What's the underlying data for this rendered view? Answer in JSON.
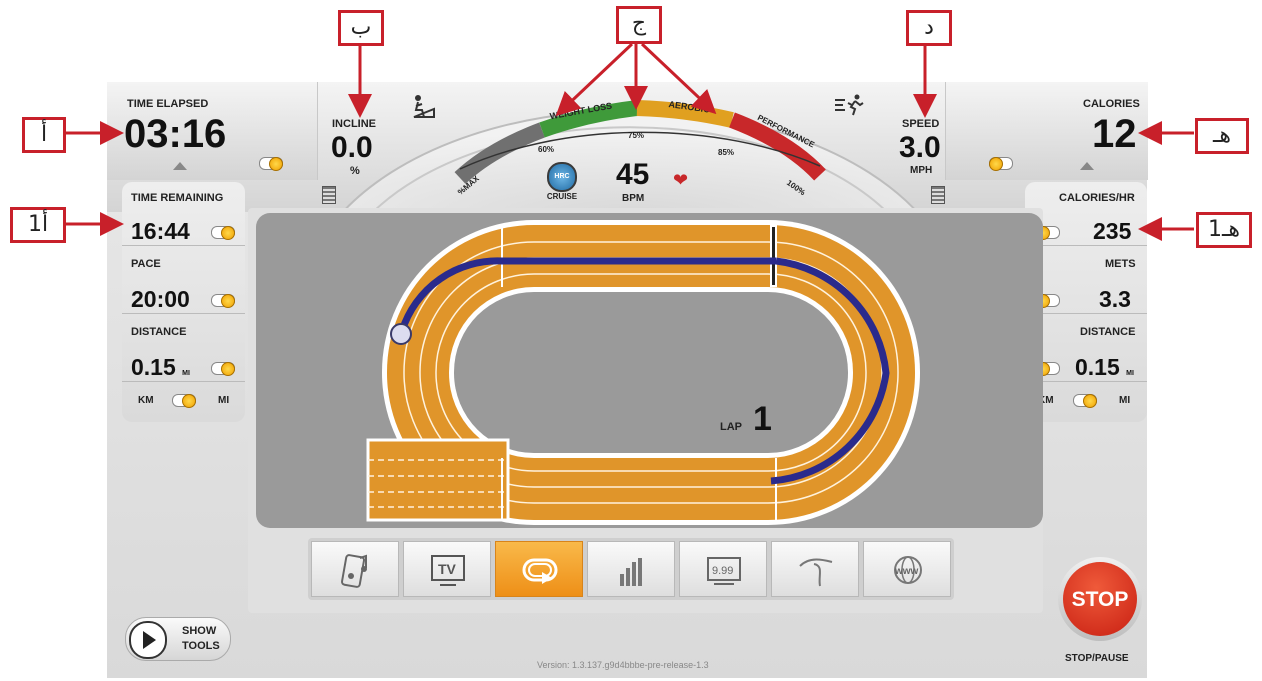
{
  "left_panel": {
    "time_elapsed_label": "TIME ELAPSED",
    "time_elapsed_value": "03:16",
    "time_remaining_label": "TIME REMAINING",
    "time_remaining_value": "16:44",
    "pace_label": "PACE",
    "pace_value": "20:00",
    "distance_label": "DISTANCE",
    "distance_value": "0.15",
    "distance_unit": "MI",
    "km_label": "KM",
    "mi_label": "MI"
  },
  "right_panel": {
    "calories_label": "CALORIES",
    "calories_value": "12",
    "calories_hr_label": "CALORIES/HR",
    "calories_hr_value": "235",
    "mets_label": "METS",
    "mets_value": "3.3",
    "distance_label": "DISTANCE",
    "distance_value": "0.15",
    "distance_unit": "MI",
    "km_label": "KM",
    "mi_label": "MI"
  },
  "incline": {
    "label": "INCLINE",
    "value": "0.0",
    "unit": "%"
  },
  "speed": {
    "label": "SPEED",
    "value": "3.0",
    "unit": "MPH"
  },
  "heart_rate": {
    "value": "45",
    "unit": "BPM",
    "hrc_label": "HRC",
    "cruise_label": "CRUISE",
    "zones": [
      "WEIGHT LOSS",
      "AEROBIC",
      "PERFORMANCE"
    ],
    "ticks": [
      "%MAX",
      "60%",
      "75%",
      "85%",
      "100%"
    ],
    "zone_colors": [
      "#707070",
      "#3f9a3a",
      "#e0a020",
      "#c8282a"
    ]
  },
  "track": {
    "lap_label": "LAP",
    "lap_value": "1",
    "progress_fraction": 0.04
  },
  "toolbar": {
    "items": [
      "music-icon",
      "tv-icon",
      "track-icon",
      "chart-icon",
      "display-icon",
      "course-icon",
      "web-icon"
    ],
    "tv_label": "TV",
    "display_label": "9.99",
    "web_label": "www",
    "active_index": 2
  },
  "show_tools": {
    "line1": "SHOW",
    "line2": "TOOLS"
  },
  "stop": {
    "label": "STOP",
    "caption": "STOP/PAUSE"
  },
  "version": "Version: 1.3.137.g9d4bbbe-pre-release-1.3",
  "callouts": {
    "a": "أ",
    "a1": "أ1",
    "b": "ب",
    "c": "ج",
    "d": "د",
    "e": "هـ",
    "e1": "هـ1"
  }
}
